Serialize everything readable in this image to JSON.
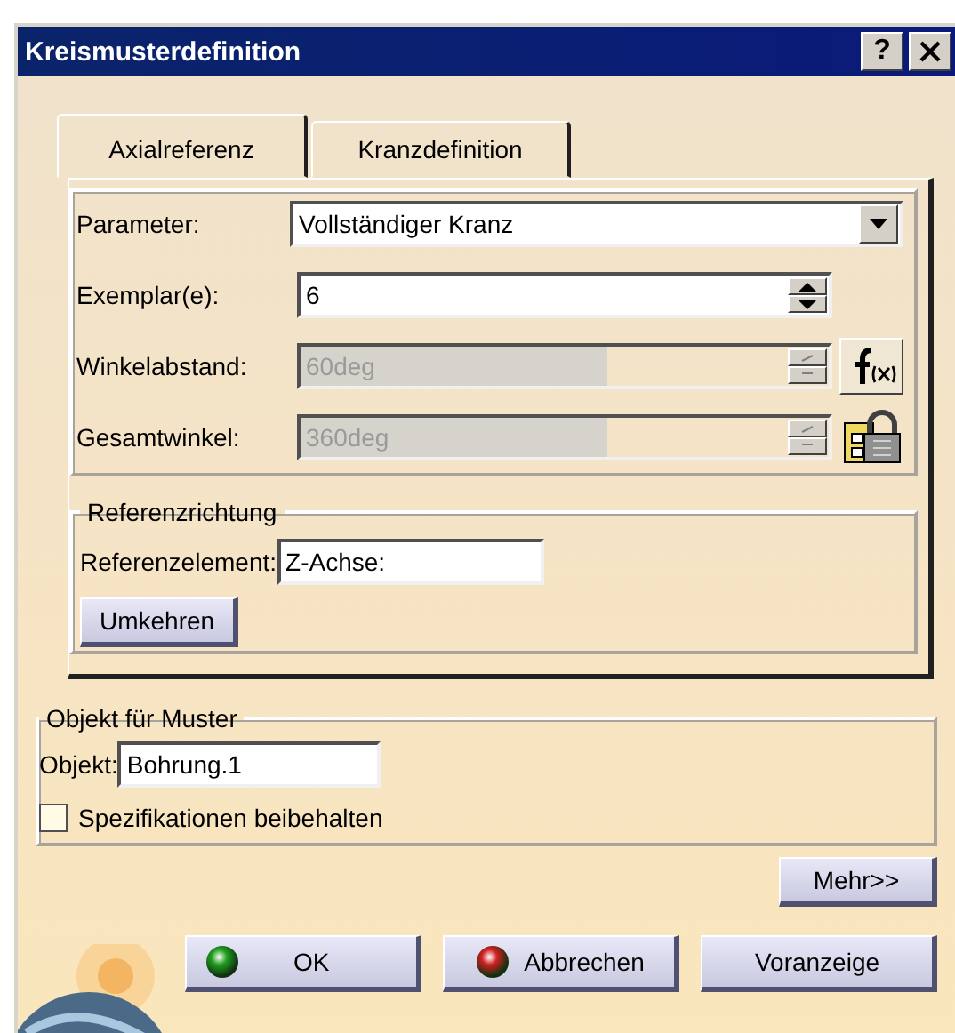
{
  "window": {
    "title": "Kreismusterdefinition",
    "help": "?"
  },
  "tabs": [
    {
      "label": "Axialreferenz",
      "selected": true
    },
    {
      "label": "Kranzdefinition",
      "selected": false
    }
  ],
  "parameters": [
    {
      "kind": "dropdown",
      "label": "Parameter:",
      "value": "Vollständiger Kranz",
      "disabled": false
    },
    {
      "kind": "spinner",
      "label": "Exemplar(e):",
      "value": "6",
      "disabled": false
    },
    {
      "kind": "spinner",
      "label": "Winkelabstand:",
      "value": "60deg",
      "disabled": true,
      "formula_button": true
    },
    {
      "kind": "spinner",
      "label": "Gesamtwinkel:",
      "value": "360deg",
      "disabled": true,
      "locked": true
    }
  ],
  "reference_direction": {
    "title": "Referenzrichtung",
    "label": "Referenzelement:",
    "value": "Z-Achse:",
    "button": "Umkehren"
  },
  "pattern_object": {
    "title": "Objekt für Muster",
    "label": "Objekt:",
    "value": "Bohrung.1",
    "checkbox": {
      "label": "Spezifikationen beibehalten",
      "checked": false
    }
  },
  "more_button": "Mehr>>",
  "buttons": [
    {
      "kind": "ok",
      "label": "OK"
    },
    {
      "kind": "cancel",
      "label": "Abbrechen"
    },
    {
      "kind": "plain",
      "label": "Voranzeige"
    }
  ]
}
